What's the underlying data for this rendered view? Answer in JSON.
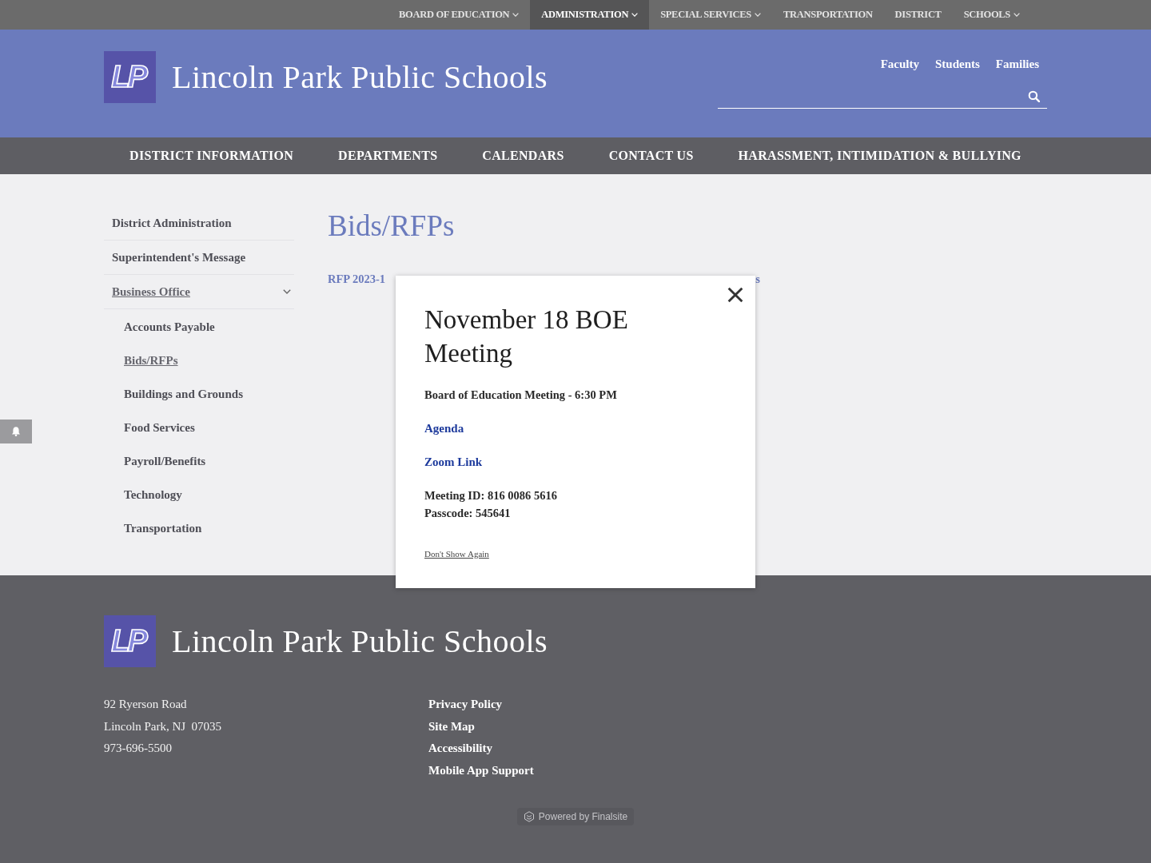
{
  "top_nav": [
    {
      "label": "BOARD OF EDUCATION",
      "dropdown": true,
      "selected": false
    },
    {
      "label": "ADMINISTRATION",
      "dropdown": true,
      "selected": true
    },
    {
      "label": "SPECIAL SERVICES",
      "dropdown": true,
      "selected": false
    },
    {
      "label": "TRANSPORTATION",
      "dropdown": false,
      "selected": false
    },
    {
      "label": "DISTRICT",
      "dropdown": false,
      "selected": false
    },
    {
      "label": "SCHOOLS",
      "dropdown": true,
      "selected": false
    }
  ],
  "header": {
    "logo_text": "LP",
    "site_title": "Lincoln Park Public Schools",
    "audience_links": [
      "Faculty",
      "Students",
      "Families"
    ]
  },
  "main_nav": [
    "DISTRICT INFORMATION",
    "DEPARTMENTS",
    "CALENDARS",
    "CONTACT US",
    "HARASSMENT, INTIMIDATION & BULLYING"
  ],
  "sidebar": {
    "items": [
      {
        "label": "District Administration",
        "selected": false
      },
      {
        "label": "Superintendent's Message",
        "selected": false
      },
      {
        "label": "Business Office",
        "selected": true,
        "expanded": true,
        "children": [
          {
            "label": "Accounts Payable",
            "selected": false
          },
          {
            "label": "Bids/RFPs",
            "selected": true
          },
          {
            "label": "Buildings and Grounds",
            "selected": false
          },
          {
            "label": "Food Services",
            "selected": false
          },
          {
            "label": "Payroll/Benefits",
            "selected": false
          },
          {
            "label": "Technology",
            "selected": false
          },
          {
            "label": "Transportation",
            "selected": false
          }
        ]
      }
    ]
  },
  "page": {
    "title": "Bids/RFPs",
    "rfp_link": {
      "visible_start": "RFP 2023-1",
      "visible_end": "s"
    }
  },
  "popup": {
    "title": "November 18 BOE Meeting",
    "subtitle": "Board of Education Meeting - 6:30 PM",
    "links": [
      "Agenda",
      "Zoom Link"
    ],
    "details": [
      "Meeting ID: 816 0086 5616",
      "Passcode: 545641"
    ],
    "dismiss": "Don't Show Again"
  },
  "footer": {
    "logo_text": "LP",
    "site_title": "Lincoln Park Public Schools",
    "address": [
      "92 Ryerson Road",
      "Lincoln Park, NJ  07035",
      "973-696-5500"
    ],
    "links": [
      "Privacy Policy",
      "Site Map",
      "Accessibility",
      "Mobile App Support"
    ],
    "powered_by": "Powered by Finalsite"
  }
}
